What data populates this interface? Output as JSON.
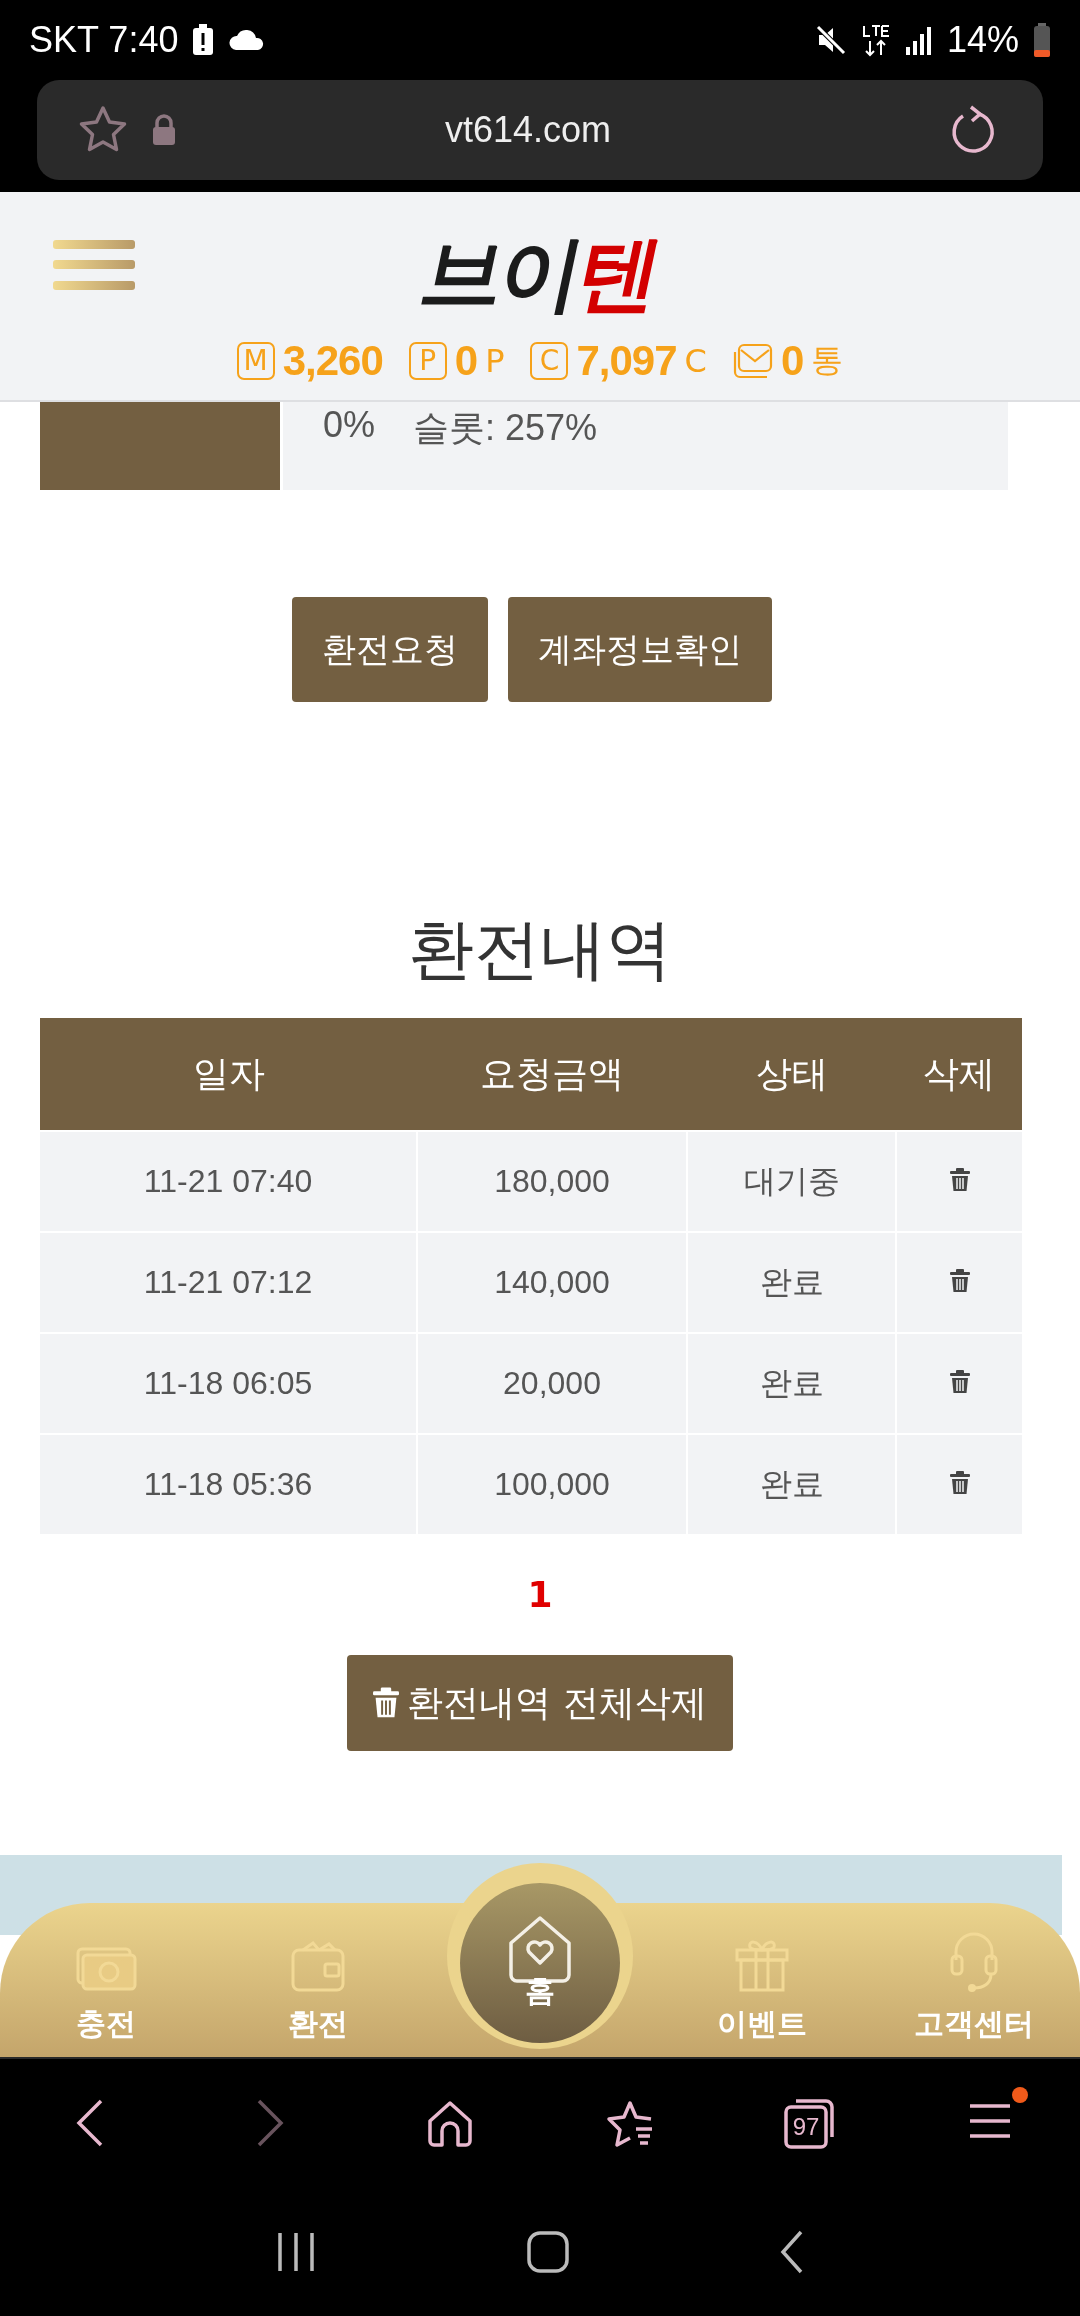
{
  "status_bar": {
    "carrier_time": "SKT 7:40",
    "battery": "14%"
  },
  "address_bar": {
    "url": "vt614.com"
  },
  "header": {
    "logo": [
      {
        "text": "브이",
        "color": "#1b1b1b"
      },
      {
        "text": "텐",
        "color": "#d30000"
      }
    ],
    "stats": [
      {
        "kind": "letter",
        "icon": "M",
        "value": "3,260"
      },
      {
        "kind": "letter",
        "icon": "P",
        "value": "0",
        "unit": "P"
      },
      {
        "kind": "letter",
        "icon": "C",
        "value": "7,097",
        "unit": "C"
      },
      {
        "kind": "mail",
        "value": "0",
        "unit": "통"
      }
    ]
  },
  "rate_panel": {
    "texts": [
      "0%",
      "슬롯: 257%"
    ]
  },
  "actions": [
    "환전요청",
    "계좌정보확인"
  ],
  "history": {
    "title": "환전내역",
    "columns": [
      "일자",
      "요청금액",
      "상태",
      "삭제"
    ],
    "rows": [
      {
        "date": "11-21 07:40",
        "amount": "180,000",
        "status": "대기중"
      },
      {
        "date": "11-21 07:12",
        "amount": "140,000",
        "status": "완료"
      },
      {
        "date": "11-18 06:05",
        "amount": "20,000",
        "status": "완료"
      },
      {
        "date": "11-18 05:36",
        "amount": "100,000",
        "status": "완료"
      }
    ],
    "pages": [
      {
        "label": "1",
        "selected": true
      }
    ],
    "delete_all": "환전내역 전체삭제"
  },
  "bottom_nav": [
    {
      "kind": "deposit",
      "label": "충전"
    },
    {
      "kind": "withdraw",
      "label": "환전"
    },
    {
      "kind": "home",
      "label": "홈"
    },
    {
      "kind": "event",
      "label": "이벤트"
    },
    {
      "kind": "support",
      "label": "고객센터"
    }
  ],
  "browser_toolbar": [
    {
      "kind": "back",
      "disabled": false
    },
    {
      "kind": "forward",
      "disabled": true
    },
    {
      "kind": "home",
      "disabled": false
    },
    {
      "kind": "bookmarks",
      "disabled": false
    },
    {
      "kind": "tabs",
      "count": "97",
      "disabled": false
    },
    {
      "kind": "menu",
      "badge": true,
      "disabled": false
    }
  ]
}
